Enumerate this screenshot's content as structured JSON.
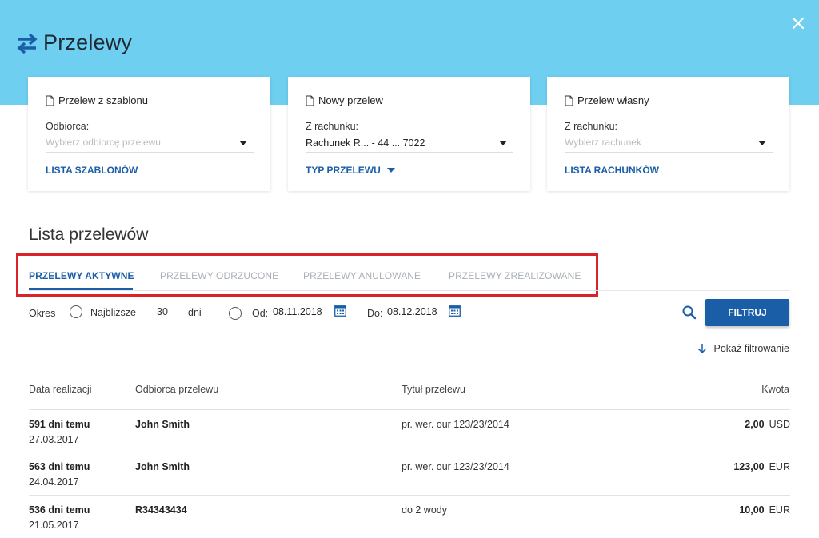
{
  "header": {
    "title": "Przelewy",
    "close_icon": "close-icon",
    "transfer_icon": "transfer-arrows-icon",
    "colors": {
      "band": "#6fcff0",
      "accent": "#1b5ea8",
      "highlight": "#d9222a"
    }
  },
  "cards": [
    {
      "title": "Przelew z szablonu",
      "label": "Odbiorca:",
      "select_value": "",
      "select_placeholder": "Wybierz odbiorcę przelewu",
      "link": "LISTA SZABLONÓW"
    },
    {
      "title": "Nowy przelew",
      "label": "Z rachunku:",
      "select_value": "Rachunek R... - 44 ... 7022",
      "select_placeholder": "",
      "link": "TYP PRZELEWU"
    },
    {
      "title": "Przelew własny",
      "label": "Z rachunku:",
      "select_value": "",
      "select_placeholder": "Wybierz rachunek",
      "link": "LISTA RACHUNKÓW"
    }
  ],
  "list": {
    "title": "Lista przelewów",
    "tabs": [
      {
        "label": "PRZELEWY AKTYWNE",
        "active": true
      },
      {
        "label": "PRZELEWY ODRZUCONE",
        "active": false
      },
      {
        "label": "PRZELEWY ANULOWANE",
        "active": false
      },
      {
        "label": "PRZELEWY ZREALIZOWANE",
        "active": false
      }
    ],
    "filter": {
      "period_label": "Okres",
      "nearest_label": "Najbliższe",
      "days_value": "30",
      "days_label": "dni",
      "from_label": "Od:",
      "from_value": "08.11.2018",
      "to_label": "Do:",
      "to_value": "08.12.2018",
      "filter_button": "FILTRUJ",
      "show_filtering": "Pokaż filtrowanie"
    },
    "columns": [
      "Data realizacji",
      "Odbiorca przelewu",
      "Tytuł przelewu",
      "Kwota"
    ],
    "rows": [
      {
        "ago": "591 dni temu",
        "date": "27.03.2017",
        "recipient": "John Smith",
        "title": "pr. wer. our 123/23/2014",
        "amount": "2,00",
        "currency": "USD"
      },
      {
        "ago": "563 dni temu",
        "date": "24.04.2017",
        "recipient": "John Smith",
        "title": "pr. wer. our 123/23/2014",
        "amount": "123,00",
        "currency": "EUR"
      },
      {
        "ago": "536 dni temu",
        "date": "21.05.2017",
        "recipient": "R34343434",
        "title": "do 2 wody",
        "amount": "10,00",
        "currency": "EUR"
      }
    ]
  }
}
